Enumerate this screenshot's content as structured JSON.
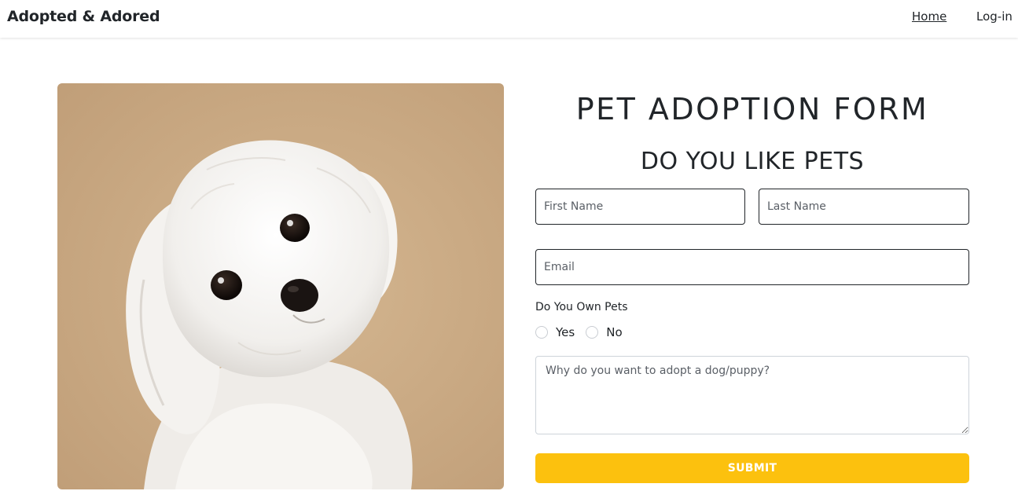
{
  "nav": {
    "brand": "Adopted & Adored",
    "links": [
      "Home",
      "Log-in"
    ]
  },
  "hero_image": {
    "subject": "white-dog-photo",
    "background_color": "#c8a882"
  },
  "form": {
    "title": "PET ADOPTION FORM",
    "subtitle": "DO YOU LIKE PETS",
    "first_name_placeholder": "First Name",
    "last_name_placeholder": "Last Name",
    "email_placeholder": "Email",
    "own_pets_label": "Do You Own Pets",
    "options": [
      "Yes",
      "No"
    ],
    "reason_placeholder": "Why do you want to adopt a dog/puppy?",
    "submit_label": "SUBMIT",
    "submit_color": "#fcc10e"
  }
}
